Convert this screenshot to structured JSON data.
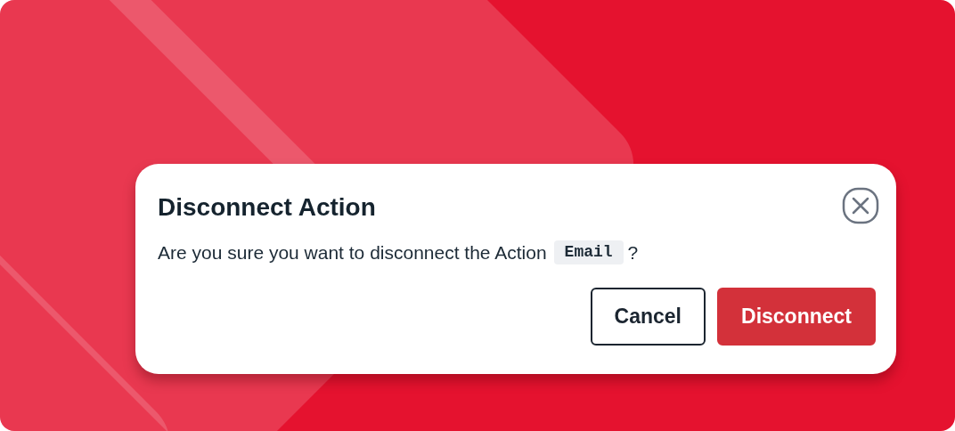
{
  "dialog": {
    "title": "Disconnect Action",
    "message": {
      "prefix": "Are you sure you want to disconnect the Action",
      "code": "Email",
      "suffix": "?"
    },
    "buttons": [
      {
        "label": "Cancel",
        "kind": "secondary"
      },
      {
        "label": "Disconnect",
        "kind": "primary"
      }
    ]
  }
}
